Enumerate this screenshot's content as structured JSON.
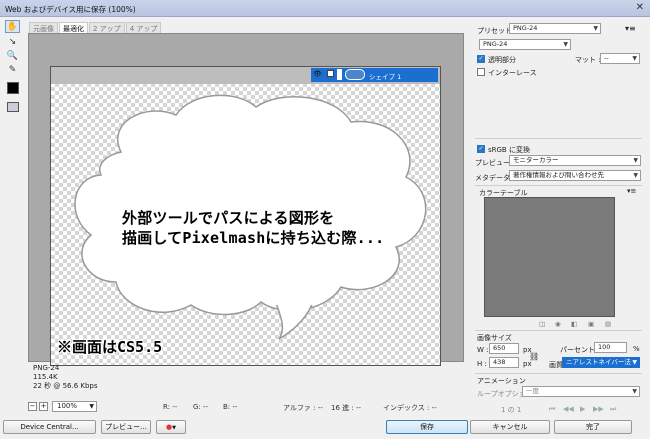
{
  "window": {
    "title": "Web およびデバイス用に保存 (100%)",
    "close_glyph": "✕"
  },
  "tools": [
    {
      "name": "hand-icon",
      "glyph": "✋"
    },
    {
      "name": "slice-select-icon",
      "glyph": "↘"
    },
    {
      "name": "zoom-icon",
      "glyph": "🔍"
    },
    {
      "name": "eyedropper-icon",
      "glyph": "✎"
    }
  ],
  "tabs": [
    "元画像",
    "最適化",
    "2 アップ",
    "4 アップ"
  ],
  "canvas": {
    "layer_name": "シェイプ 1",
    "bubble_line1": "外部ツールでパスによる図形を",
    "bubble_line2": "描画してPixelmashに持ち込む際...",
    "note": "※画面はCS5.5"
  },
  "info": {
    "format": "PNG-24",
    "size": "115.4K",
    "time": "22 秒 @ 56.6 Kbps"
  },
  "status": {
    "zoom": "100%",
    "r": "R: --",
    "g": "G: --",
    "b": "B: --",
    "alpha": "アルファ : --",
    "hex": "16 進 : --",
    "index": "インデックス : --"
  },
  "buttons": {
    "device_central": "Device Central...",
    "preview": "プレビュー...",
    "save": "保存",
    "cancel": "キャンセル",
    "done": "完了"
  },
  "panel": {
    "preset_label": "プリセット :",
    "preset_value": "PNG-24",
    "format_value": "PNG-24",
    "transparency": "透明部分",
    "matte_label": "マット :",
    "matte_value": "--",
    "interlace": "インターレース",
    "srgb": "sRGB に変換",
    "preview_label": "プレビュー :",
    "preview_value": "モニターカラー",
    "metadata_label": "メタデータ :",
    "metadata_value": "著作権情報および問い合わせ先",
    "color_table": "カラーテーブル",
    "image_size": "画像サイズ",
    "w_label": "W :",
    "w_value": "650",
    "h_label": "H :",
    "h_value": "438",
    "px": "px",
    "percent_label": "パーセント :",
    "percent_value": "100",
    "percent_unit": "%",
    "quality_label": "画質 :",
    "quality_value": "ニアレストネイバー法",
    "animation": "アニメーション",
    "loop_label": "ループオプション :",
    "loop_value": "一度",
    "frame_counter": "1 の 1"
  }
}
